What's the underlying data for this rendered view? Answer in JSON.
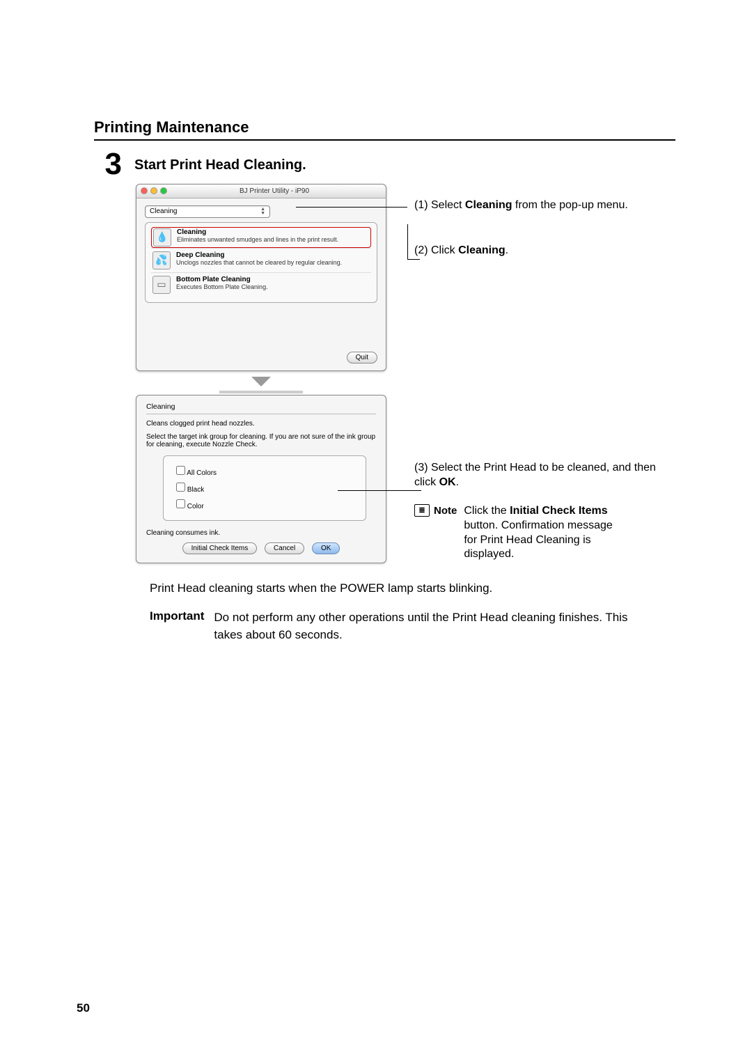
{
  "page": {
    "section_title": "Printing Maintenance",
    "page_number": "50"
  },
  "step": {
    "number": "3",
    "title": "Start Print Head Cleaning."
  },
  "window1": {
    "title": "BJ Printer Utility - iP90",
    "popup_selected": "Cleaning",
    "items": [
      {
        "name": "Cleaning",
        "desc": "Eliminates unwanted smudges and lines in the print result.",
        "glyph": "💧"
      },
      {
        "name": "Deep Cleaning",
        "desc": "Unclogs nozzles that cannot be cleared by regular cleaning.",
        "glyph": "💦"
      },
      {
        "name": "Bottom Plate Cleaning",
        "desc": "Executes Bottom Plate Cleaning.",
        "glyph": "▭"
      }
    ],
    "quit": "Quit"
  },
  "dialog": {
    "title": "Cleaning",
    "subtitle": "Cleans clogged print head nozzles.",
    "instruction": "Select the target ink group for cleaning. If you are not sure of the ink group for cleaning, execute Nozzle Check.",
    "options": [
      "All Colors",
      "Black",
      "Color"
    ],
    "footer_note": "Cleaning consumes ink.",
    "buttons": {
      "initial": "Initial Check Items",
      "cancel": "Cancel",
      "ok": "OK"
    }
  },
  "annotations": {
    "a1_pre": "(1) Select ",
    "a1_bold": "Cleaning",
    "a1_post": " from the pop-up menu.",
    "a2_pre": "(2) Click ",
    "a2_bold": "Cleaning",
    "a2_post": ".",
    "a3_pre": "(3) Select the Print Head to be cleaned, and then click ",
    "a3_bold": "OK",
    "a3_post": "."
  },
  "note": {
    "label": "Note",
    "text_pre": "Click the ",
    "text_bold": "Initial Check Items",
    "text_post": " button. Confirmation message for Print Head Cleaning is displayed."
  },
  "paragraph": "Print Head cleaning starts when the POWER lamp starts blinking.",
  "important": {
    "label": "Important",
    "text": "Do not perform any other operations until the Print Head cleaning finishes. This takes about 60 seconds."
  }
}
